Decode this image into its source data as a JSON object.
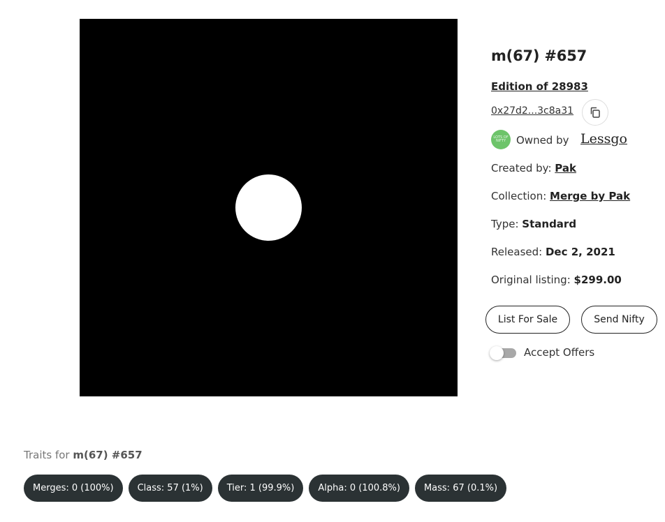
{
  "nft": {
    "title": "m(67) #657",
    "edition": "Edition of 28983",
    "address": "0x27d2...3c8a31",
    "copy_icon": "copy-icon",
    "owner": {
      "prefix": "Owned by",
      "name": "Lessgo",
      "avatar_text": "LOTS OF NIFTY",
      "avatar_color": "#6dc46a"
    },
    "meta": {
      "created_label": "Created by:",
      "created_value": "Pak",
      "collection_label": "Collection:",
      "collection_value": "Merge by Pak",
      "type_label": "Type:",
      "type_value": "Standard",
      "released_label": "Released:",
      "released_value": "Dec 2, 2021",
      "listing_label": "Original listing:",
      "listing_value": "$299.00"
    }
  },
  "actions": {
    "list_for_sale": "List For Sale",
    "send_nifty": "Send Nifty",
    "accept_offers_label": "Accept Offers",
    "accept_offers_on": false
  },
  "traits": {
    "heading_prefix": "Traits for",
    "heading_name": "m(67) #657",
    "items": [
      "Merges: 0 (100%)",
      "Class: 57 (1%)",
      "Tier: 1 (99.9%)",
      "Alpha: 0 (100.8%)",
      "Mass: 67 (0.1%)"
    ]
  },
  "colors": {
    "artwork_bg": "#000000",
    "artwork_circle": "#ffffff",
    "trait_bg": "#2b3234"
  }
}
